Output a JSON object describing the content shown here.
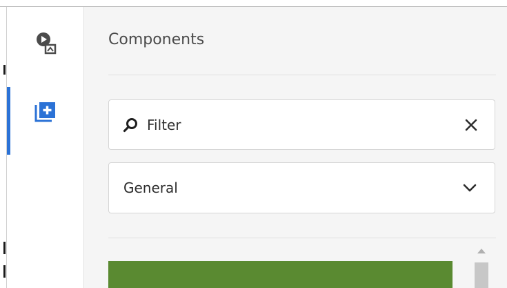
{
  "rail": {
    "items": [
      {
        "name": "assets",
        "icon": "assets-icon",
        "active": false
      },
      {
        "name": "components",
        "icon": "components-icon",
        "active": true
      }
    ]
  },
  "panel": {
    "title": "Components",
    "filter": {
      "placeholder": "Filter",
      "value": ""
    },
    "group": {
      "selected": "General"
    }
  },
  "colors": {
    "accent": "#2b72d6",
    "component_tile": "#5a8a31",
    "panel_bg": "#f5f5f5"
  }
}
